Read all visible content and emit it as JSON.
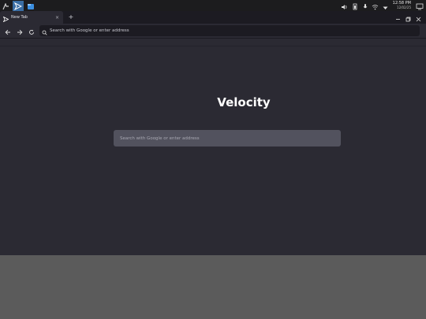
{
  "taskbar": {
    "apps": [
      {
        "icon": "app-launcher-icon"
      },
      {
        "icon": "velocity-browser-icon",
        "active": true
      },
      {
        "icon": "file-manager-icon"
      }
    ],
    "tray": [
      "volume-icon",
      "battery-icon",
      "microphone-icon",
      "wifi-icon",
      "chevron-down-icon"
    ],
    "clock": {
      "time": "12:58 PM",
      "date": "12/02/25"
    }
  },
  "tabs": [
    {
      "label": "New Tab",
      "close": "×"
    }
  ],
  "new_tab_label": "+",
  "window_controls": {
    "minimize": "–",
    "restore": "❐",
    "close": "×"
  },
  "url_bar": {
    "placeholder": "Search with Google or enter address",
    "value": ""
  },
  "page": {
    "brand": "Velocity",
    "search_placeholder": "Search with Google or enter address"
  },
  "colors": {
    "accent": "#3a6ea5",
    "page_bg": "#2b2a33",
    "tabbar_bg": "#1c1b22",
    "search_bg": "#52525e",
    "desktop": "#5b5b5b"
  }
}
